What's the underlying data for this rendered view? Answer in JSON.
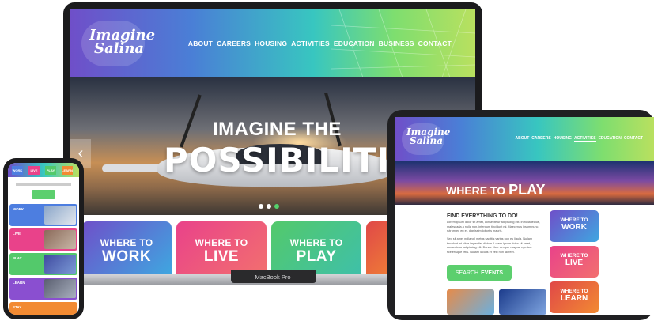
{
  "laptop": {
    "logo": {
      "line1": "Imagine",
      "line2": "Salina"
    },
    "nav": [
      "ABOUT",
      "CAREERS",
      "HOUSING",
      "ACTIVITIES",
      "EDUCATION",
      "BUSINESS",
      "CONTACT"
    ],
    "hero": {
      "line1": "IMAGINE THE",
      "line2": "POSSIBILITIES",
      "prev_icon": "‹"
    },
    "cards": [
      {
        "line1": "WHERE TO",
        "line2": "WORK",
        "color": "#4d7ee0"
      },
      {
        "line1": "WHERE TO",
        "line2": "LIVE",
        "color": "#e9428a"
      },
      {
        "line1": "WHERE TO",
        "line2": "PLAY",
        "color": "#53c96b"
      }
    ],
    "brand": "MacBook Pro"
  },
  "tablet": {
    "logo": {
      "line1": "Imagine",
      "line2": "Salina"
    },
    "nav": [
      "ABOUT",
      "CAREERS",
      "HOUSING",
      "ACTIVITIES",
      "EDUCATION",
      "CONTACT"
    ],
    "hero": {
      "line1": "WHERE TO",
      "line2": "PLAY"
    },
    "find_heading": "FIND EVERYTHING TO DO!",
    "paragraph1": "Lorem ipsum dolor sit amet, consectetur adipiscing elit. In nulla lectus, malesuada a nulla non, interdum tincidunt mi. Maecenas ipsum nunc, rutrum eu eu et, dignissim lobortis mauris.",
    "paragraph2": "Sed sit amet nulla vel metus sagittis varius non eu ligula. Nullam tincidunt mi vitae imperdiet dictum. Lorem ipsum dolor sit amet, consectetur adipiscing elit. Donec vitae semper magna, egestas scelerisque felis. Nullam iaculis et velit non laoreet.",
    "search": {
      "label": "SEARCH",
      "bold": "EVENTS"
    },
    "cards": [
      {
        "line1": "WHERE TO",
        "line2": "WORK",
        "color": "#4d7ee0"
      },
      {
        "line1": "WHERE TO",
        "line2": "LIVE",
        "color": "#e9428a"
      },
      {
        "line1": "WHERE TO",
        "line2": "LEARN",
        "color": "#f28a32"
      }
    ]
  },
  "phone": {
    "tiles": [
      "WORK",
      "LIVE",
      "PLAY",
      "LEARN"
    ],
    "rows": [
      {
        "label": "WORK",
        "color": "#4d7ee0"
      },
      {
        "label": "LIVE",
        "color": "#e9428a"
      },
      {
        "label": "PLAY",
        "color": "#53c96b"
      },
      {
        "label": "LEARN",
        "color": "#8a4fd0"
      },
      {
        "label": "STAY",
        "color": "#f28a32"
      }
    ]
  }
}
